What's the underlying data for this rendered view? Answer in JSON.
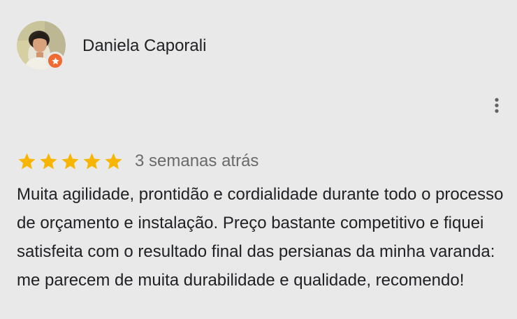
{
  "reviewer": {
    "name": "Daniela Caporali",
    "avatar_icon": "profile-photo",
    "badge_icon": "local-guide-star-icon",
    "badge_color": "#f06a33"
  },
  "menu": {
    "icon": "more-vertical-icon"
  },
  "review": {
    "rating": 5,
    "max_rating": 5,
    "star_color": "#f7b500",
    "timestamp": "3 semanas atrás",
    "text": "Muita agilidade, prontidão e cordialidade durante todo o processo de orçamento e instalação. Preço bastante competitivo e fiquei satisfeita com o resultado final das persianas da minha varanda:  me parecem de muita durabilidade e qualidade, recomendo!"
  }
}
